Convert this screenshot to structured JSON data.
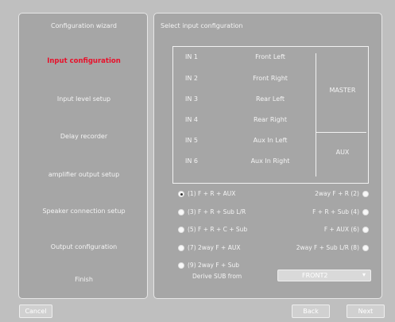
{
  "sidebar": {
    "title": "Configuration wizard",
    "steps": [
      {
        "label": "Input configuration",
        "active": true
      },
      {
        "label": "Input level setup",
        "active": false
      },
      {
        "label": "Delay recorder",
        "active": false
      },
      {
        "label": "amplifier output setup",
        "active": false
      },
      {
        "label": "Speaker connection setup",
        "active": false
      },
      {
        "label": "Output configuration",
        "active": false
      },
      {
        "label": "Finish",
        "active": false
      }
    ]
  },
  "main": {
    "title": "Select input configuration",
    "inputs": [
      {
        "in": "IN 1",
        "name": "Front Left"
      },
      {
        "in": "IN 2",
        "name": "Front Right"
      },
      {
        "in": "IN 3",
        "name": "Rear Left"
      },
      {
        "in": "IN 4",
        "name": "Rear Right"
      },
      {
        "in": "IN 5",
        "name": "Aux In Left"
      },
      {
        "in": "IN 6",
        "name": "Aux In Right"
      }
    ],
    "groups": {
      "master": "MASTER",
      "aux": "AUX"
    },
    "options_left": [
      {
        "label": "(1) F + R + AUX",
        "checked": true
      },
      {
        "label": "(3) F + R + Sub L/R",
        "checked": false
      },
      {
        "label": "(5) F + R + C + Sub",
        "checked": false
      },
      {
        "label": "(7) 2way F + AUX",
        "checked": false
      },
      {
        "label": "(9) 2way F + Sub",
        "checked": false
      }
    ],
    "options_right": [
      {
        "label": "2way F + R (2)",
        "checked": false
      },
      {
        "label": "F + R + Sub (4)",
        "checked": false
      },
      {
        "label": "F + AUX (6)",
        "checked": false
      },
      {
        "label": "2way F + Sub L/R (8)",
        "checked": false
      }
    ],
    "derive_label": "Derive SUB from",
    "derive_value": "FRONT2",
    "dropdown_arrow": "chevron-down-icon"
  },
  "footer": {
    "cancel": "Cancel",
    "back": "Back",
    "next": "Next"
  }
}
